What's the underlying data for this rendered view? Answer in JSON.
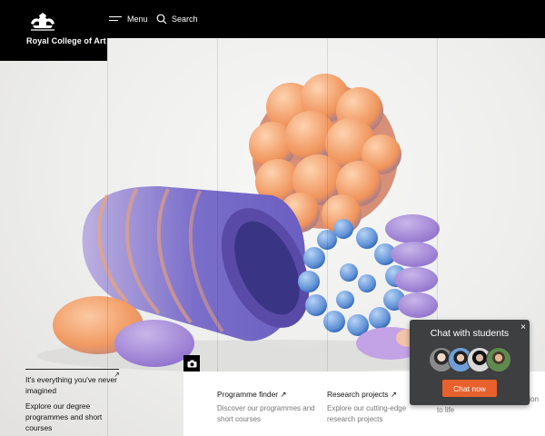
{
  "header": {
    "logo_text": "Royal College of Art",
    "menu_label": "Menu",
    "search_label": "Search",
    "icons": [
      "crest-icon",
      "hamburger-icon",
      "search-icon"
    ]
  },
  "hero": {
    "tagline_line1": "It's everything you've never imagined",
    "tagline_line2": "Explore our degree programmes and short courses",
    "arrow": "↗",
    "camera_icon": "camera-icon"
  },
  "cards": [
    {
      "title": "Programme finder ↗",
      "description": "Discover our programmes and short courses"
    },
    {
      "title": "Research projects ↗",
      "description": "Explore our cutting-edge research projects"
    },
    {
      "title": "",
      "description": "bringing art & design innovation to life"
    }
  ],
  "chat": {
    "title": "Chat with students",
    "close": "×",
    "button_label": "Chat now",
    "button_color": "#e8602c"
  }
}
